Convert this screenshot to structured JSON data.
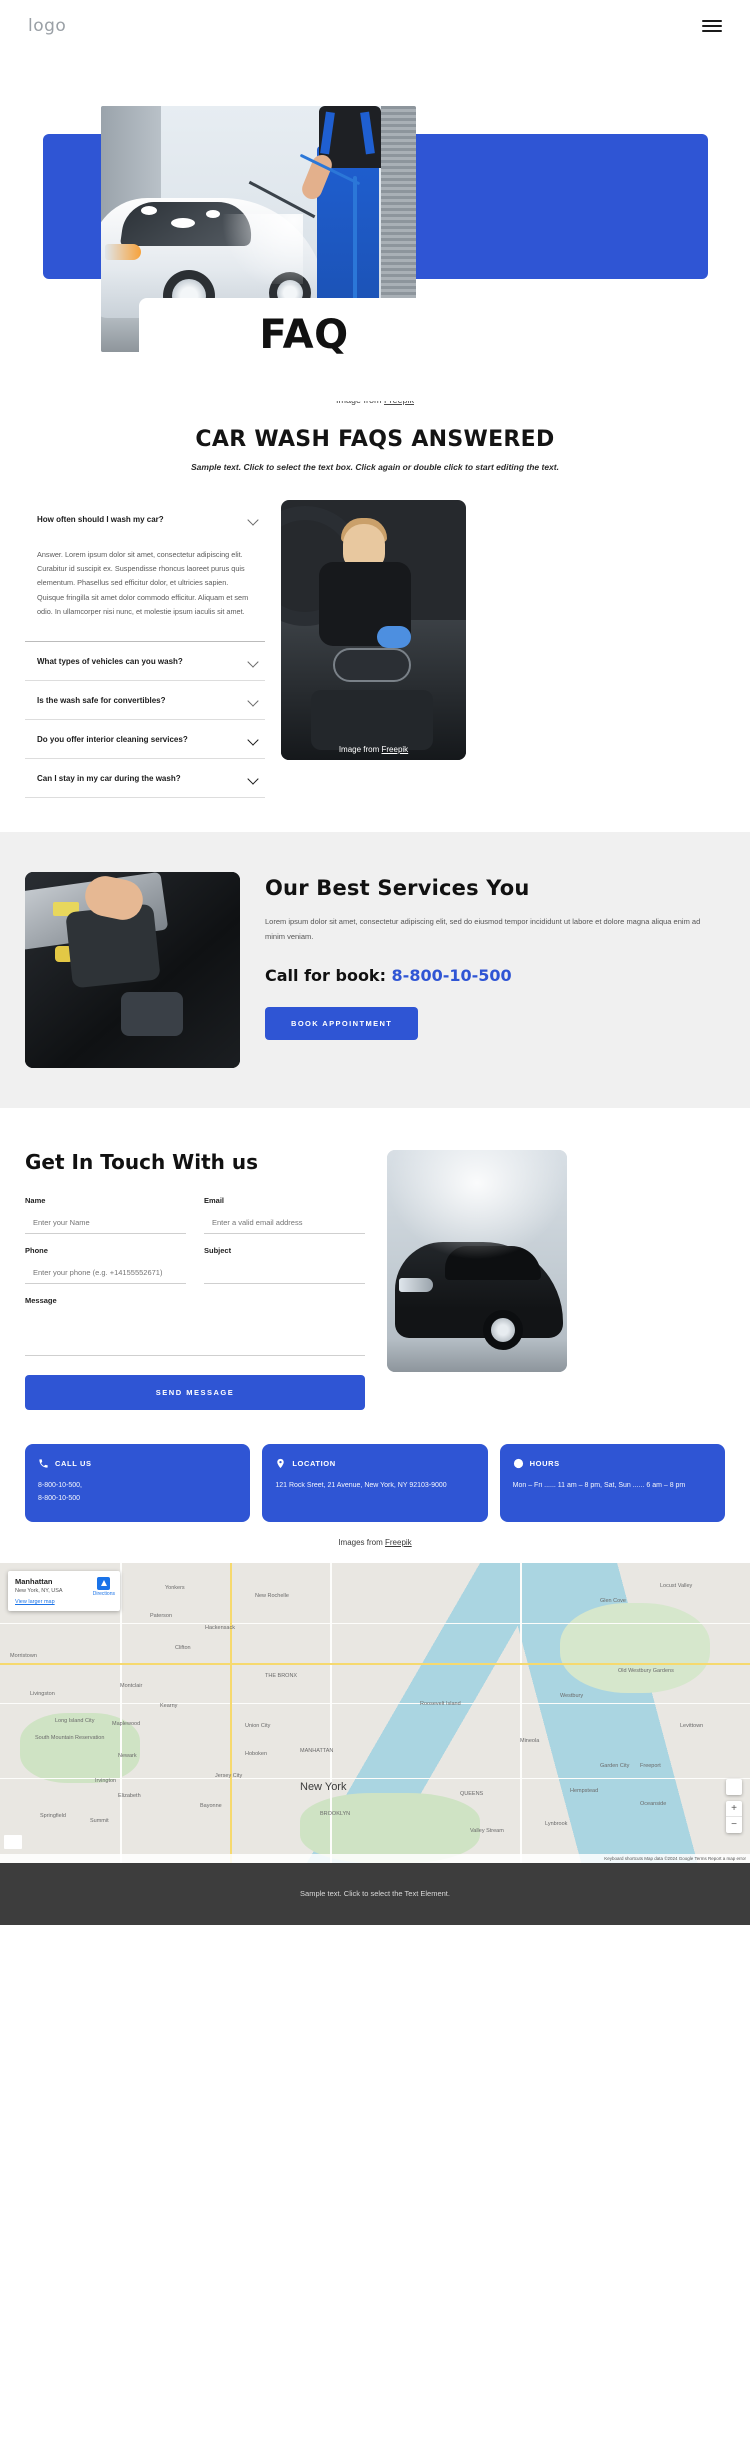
{
  "header": {
    "logo": "logo",
    "menu_icon": "hamburger-menu-icon"
  },
  "hero": {
    "title": "FAQ",
    "credit_prefix": "Image from ",
    "credit_link": "Freepik"
  },
  "faq": {
    "heading": "CAR WASH FAQS ANSWERED",
    "subheading": "Sample text. Click to select the text box. Click again or double click to start editing the text.",
    "items": [
      {
        "question": "How often should I wash my car?",
        "answer": "Answer. Lorem ipsum dolor sit amet, consectetur adipiscing elit. Curabitur id suscipit ex. Suspendisse rhoncus laoreet purus quis elementum. Phasellus sed efficitur dolor, et ultricies sapien. Quisque fringilla sit amet dolor commodo efficitur. Aliquam et sem odio. In ullamcorper nisi nunc, et molestie ipsum iaculis sit amet.",
        "expanded": true
      },
      {
        "question": "What types of vehicles can you wash?",
        "answer": "",
        "expanded": false
      },
      {
        "question": "Is the wash safe for convertibles?",
        "answer": "",
        "expanded": false
      },
      {
        "question": "Do you offer interior cleaning services?",
        "answer": "",
        "expanded": false
      },
      {
        "question": "Can I stay in my car during the wash?",
        "answer": "",
        "expanded": false
      }
    ],
    "photo_credit_prefix": "Image from ",
    "photo_credit_link": "Freepik"
  },
  "services": {
    "heading": "Our Best Services You",
    "paragraph": "Lorem ipsum dolor sit amet, consectetur adipiscing elit, sed do eiusmod tempor incididunt ut labore et dolore magna aliqua enim ad minim veniam.",
    "call_label": "Call for book:",
    "phone": "8-800-10-500",
    "button_label": "BOOK APPOINTMENT"
  },
  "contact": {
    "heading": "Get In Touch With us",
    "fields": {
      "name": {
        "label": "Name",
        "placeholder": "Enter your Name",
        "value": ""
      },
      "email": {
        "label": "Email",
        "placeholder": "Enter a valid email address",
        "value": ""
      },
      "phone": {
        "label": "Phone",
        "placeholder": "Enter your phone (e.g. +14155552671)",
        "value": ""
      },
      "subject": {
        "label": "Subject",
        "placeholder": "",
        "value": ""
      },
      "message": {
        "label": "Message",
        "placeholder": "",
        "value": ""
      }
    },
    "submit_label": "SEND MESSAGE"
  },
  "info_cards": [
    {
      "icon": "phone-icon",
      "title": "CALL US",
      "body": "8-800-10-500,\n8-800-10-500"
    },
    {
      "icon": "location-pin-icon",
      "title": "LOCATION",
      "body": "121 Rock Sreet, 21 Avenue, New York, NY 92103-9000"
    },
    {
      "icon": "clock-icon",
      "title": "HOURS",
      "body": "Mon – Fri ...... 11 am – 8 pm, Sat, Sun  ...... 6 am – 8 pm"
    }
  ],
  "images_credit": {
    "prefix": "Images from ",
    "link": "Freepik"
  },
  "map": {
    "info": {
      "title": "Manhattan",
      "subtitle": "New York, NY, USA",
      "view_larger": "View larger map",
      "directions_label": "Directions"
    },
    "main_label": "New York",
    "labels": [
      "Yonkers",
      "New Rochelle",
      "Hackensack",
      "Paterson",
      "Clifton",
      "Hoboken",
      "Jersey City",
      "Newark",
      "Bayonne",
      "Elizabeth",
      "Union City",
      "MANHATTAN",
      "BROOKLYN",
      "QUEENS",
      "THE BRONX",
      "Long Island City",
      "Glen Cove",
      "Oceanside",
      "Lynbrook",
      "Valley Stream",
      "Garden City",
      "Mineola",
      "Hempstead",
      "Freeport",
      "Levittown",
      "Locust Valley",
      "Old Westbury Gardens",
      "Westbury",
      "Roosevelt Island",
      "South Mountain Reservation",
      "Maplewood",
      "Irvington",
      "Springfield",
      "Livingston",
      "Morristown",
      "Summit",
      "Montclair",
      "Kearny"
    ],
    "zoom_in": "+",
    "zoom_out": "−",
    "bottom_bar": "Keyboard shortcuts   Map data ©2024 Google   Terms   Report a map error"
  },
  "footer": {
    "text": "Sample text. Click to select the Text Element."
  }
}
